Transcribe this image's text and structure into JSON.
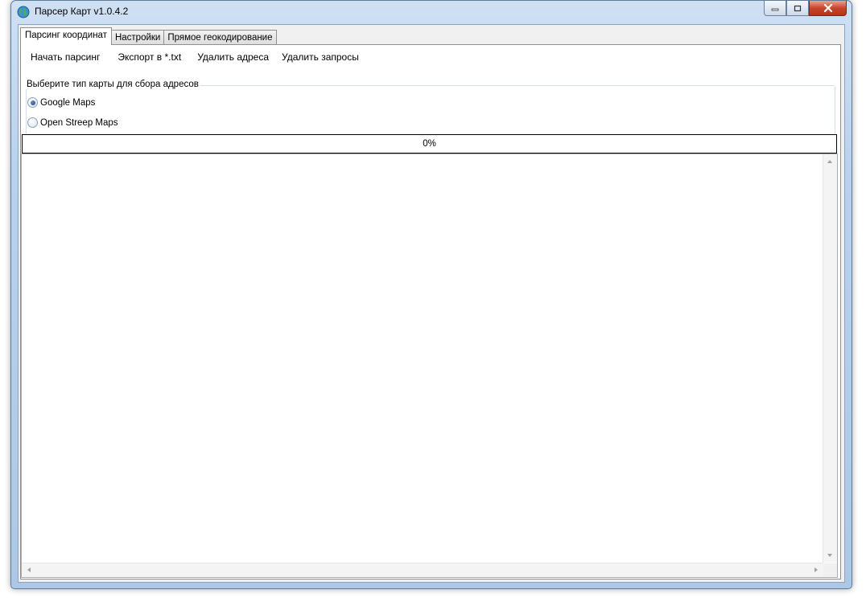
{
  "window": {
    "title": "Парсер Карт v1.0.4.2",
    "controls": {
      "minimize_icon": "minimize-icon",
      "maximize_icon": "maximize-icon",
      "close_icon": "close-icon",
      "close_color": "#c8452d"
    }
  },
  "tabs": [
    {
      "label": "Парсинг координат",
      "active": true
    },
    {
      "label": "Настройки",
      "active": false
    },
    {
      "label": "Прямое геокодирование",
      "active": false
    }
  ],
  "menu": {
    "start": "Начать парсинг",
    "export": "Экспорт в *.txt",
    "delete_addresses": "Удалить адреса",
    "delete_requests": "Удалить запросы"
  },
  "map_type_group": {
    "title": "Выберите тип карты для сбора адресов",
    "options": [
      {
        "label": "Google Maps",
        "checked": true
      },
      {
        "label": "Open Streep Maps",
        "checked": false
      }
    ]
  },
  "progress": {
    "value": 0,
    "text": "0%",
    "fill_color": "#2fb33a"
  },
  "log": {
    "text": ""
  }
}
